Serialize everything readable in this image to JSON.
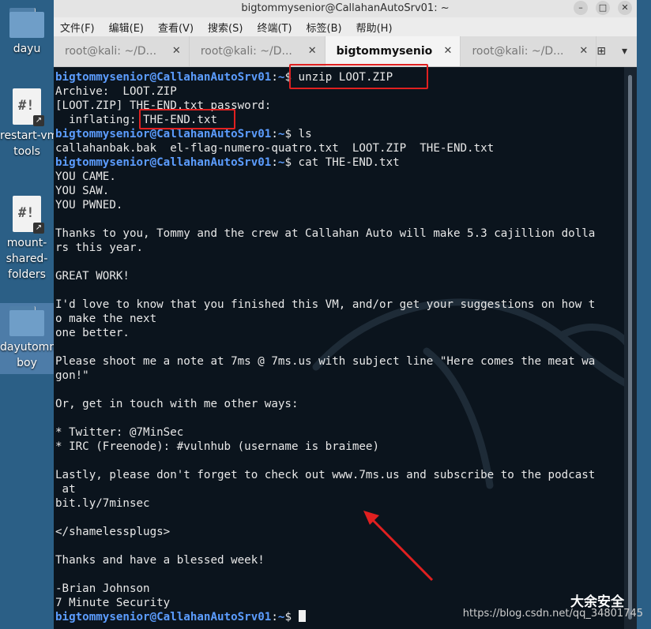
{
  "desktop": {
    "icons": [
      {
        "label": "dayu"
      },
      {
        "label": "restart-vm-\ntools"
      },
      {
        "label": "mount-\nshared-\nfolders"
      },
      {
        "label": "dayutommy\nboy"
      }
    ]
  },
  "window": {
    "title": "bigtommysenior@CallahanAutoSrv01: ~",
    "menu": [
      "文件(F)",
      "编辑(E)",
      "查看(V)",
      "搜索(S)",
      "终端(T)",
      "标签(B)",
      "帮助(H)"
    ],
    "tabs": [
      {
        "label": "root@kali: ~/D..."
      },
      {
        "label": "root@kali: ~/D..."
      },
      {
        "label": "bigtommysenio"
      },
      {
        "label": "root@kali: ~/D..."
      }
    ]
  },
  "terminal": {
    "prompt_user": "bigtommysenior@CallahanAutoSrv01",
    "prompt_path": "~",
    "lines": [
      {
        "type": "prompt",
        "cmd": "unzip LOOT.ZIP"
      },
      {
        "type": "out",
        "text": "Archive:  LOOT.ZIP"
      },
      {
        "type": "out",
        "text": "[LOOT.ZIP] THE-END.txt password:"
      },
      {
        "type": "out",
        "text": "  inflating: THE-END.txt"
      },
      {
        "type": "prompt",
        "cmd": "ls"
      },
      {
        "type": "out",
        "text": "callahanbak.bak  el-flag-numero-quatro.txt  LOOT.ZIP  THE-END.txt"
      },
      {
        "type": "prompt",
        "cmd": "cat THE-END.txt"
      },
      {
        "type": "out",
        "text": "YOU CAME."
      },
      {
        "type": "out",
        "text": "YOU SAW."
      },
      {
        "type": "out",
        "text": "YOU PWNED."
      },
      {
        "type": "out",
        "text": ""
      },
      {
        "type": "out",
        "text": "Thanks to you, Tommy and the crew at Callahan Auto will make 5.3 cajillion dolla"
      },
      {
        "type": "out",
        "text": "rs this year."
      },
      {
        "type": "out",
        "text": ""
      },
      {
        "type": "out",
        "text": "GREAT WORK!"
      },
      {
        "type": "out",
        "text": ""
      },
      {
        "type": "out",
        "text": "I'd love to know that you finished this VM, and/or get your suggestions on how t"
      },
      {
        "type": "out",
        "text": "o make the next"
      },
      {
        "type": "out",
        "text": "one better."
      },
      {
        "type": "out",
        "text": ""
      },
      {
        "type": "out",
        "text": "Please shoot me a note at 7ms @ 7ms.us with subject line \"Here comes the meat wa"
      },
      {
        "type": "out",
        "text": "gon!\""
      },
      {
        "type": "out",
        "text": ""
      },
      {
        "type": "out",
        "text": "Or, get in touch with me other ways:"
      },
      {
        "type": "out",
        "text": ""
      },
      {
        "type": "out",
        "text": "* Twitter: @7MinSec"
      },
      {
        "type": "out",
        "text": "* IRC (Freenode): #vulnhub (username is braimee)"
      },
      {
        "type": "out",
        "text": ""
      },
      {
        "type": "out",
        "text": "Lastly, please don't forget to check out www.7ms.us and subscribe to the podcast"
      },
      {
        "type": "out",
        "text": " at"
      },
      {
        "type": "out",
        "text": "bit.ly/7minsec"
      },
      {
        "type": "out",
        "text": ""
      },
      {
        "type": "out",
        "text": "</shamelessplugs>"
      },
      {
        "type": "out",
        "text": ""
      },
      {
        "type": "out",
        "text": "Thanks and have a blessed week!"
      },
      {
        "type": "out",
        "text": ""
      },
      {
        "type": "out",
        "text": "-Brian Johnson"
      },
      {
        "type": "out",
        "text": "7 Minute Security"
      },
      {
        "type": "prompt",
        "cmd": ""
      }
    ]
  },
  "watermark": {
    "brand": "大余安全",
    "url": "https://blog.csdn.net/qq_34801745"
  },
  "colors": {
    "prompt": "#5c9dff",
    "highlight": "#e02020",
    "terminal_bg": "#0b141d"
  }
}
